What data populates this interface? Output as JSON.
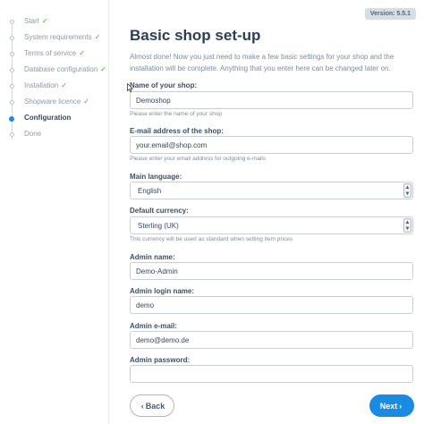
{
  "version": "Version: 5.5.1",
  "steps": [
    {
      "label": "Start",
      "done": true
    },
    {
      "label": "System requirements",
      "done": true
    },
    {
      "label": "Terms of service",
      "done": true
    },
    {
      "label": "Database configuration",
      "done": true
    },
    {
      "label": "Installation",
      "done": true
    },
    {
      "label": "Shopware licence",
      "done": true
    },
    {
      "label": "Configuration",
      "done": false,
      "active": true
    },
    {
      "label": "Done",
      "done": false
    }
  ],
  "check_glyph": "✓",
  "title": "Basic shop set-up",
  "intro": "Almost done! Now you just need to make a few basic settings for your shop and the installation will be complete. Anything that you enter here can be changed later on.",
  "fields": {
    "shop_name": {
      "label": "Name of your shop:",
      "value": "Demoshop",
      "hint": "Please enter the name of your shop"
    },
    "shop_email": {
      "label": "E-mail address of the shop:",
      "value": "your.email@shop.com",
      "hint": "Please enter your email address for outgoing e-mails"
    },
    "language": {
      "label": "Main language:",
      "value": "English"
    },
    "currency": {
      "label": "Default currency:",
      "value": "Sterling (UK)",
      "hint": "This currency will be used as standard when setting item prices"
    },
    "admin_name": {
      "label": "Admin name:",
      "value": "Demo-Admin"
    },
    "admin_login": {
      "label": "Admin login name:",
      "value": "demo"
    },
    "admin_email": {
      "label": "Admin e-mail:",
      "value": "demo@demo.de"
    },
    "admin_password": {
      "label": "Admin password:",
      "value": ""
    }
  },
  "buttons": {
    "back": "Back",
    "next": "Next"
  },
  "icons": {
    "back": "chevron-left-icon",
    "next": "chevron-right-icon",
    "select": "select-arrows-icon"
  },
  "colors": {
    "accent": "#1a8be2",
    "check": "#36b02b"
  }
}
